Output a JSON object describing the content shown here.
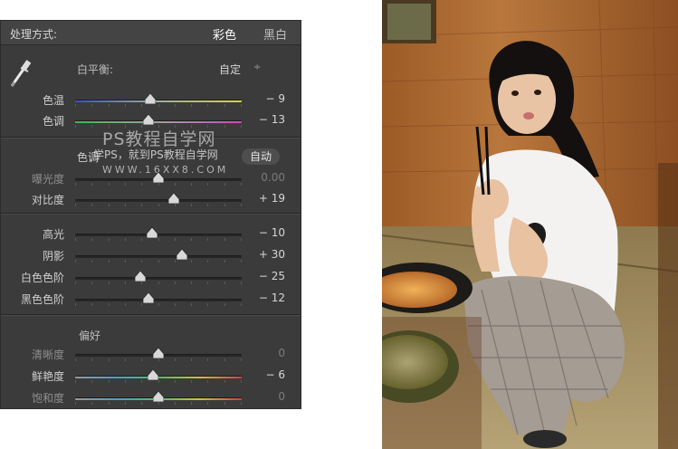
{
  "panel": {
    "header": {
      "title": "处理方式:",
      "option_color": "彩色",
      "option_bw": "黑白"
    },
    "white_balance": {
      "label": "白平衡:",
      "value": "自定",
      "caret": "÷"
    },
    "wb_sliders": [
      {
        "label": "色温",
        "value": "− 9",
        "fraction": 0.45,
        "dim": false
      },
      {
        "label": "色调",
        "value": "− 13",
        "fraction": 0.44,
        "dim": false
      }
    ],
    "tone": {
      "label": "色调",
      "auto": "自动"
    },
    "tone_sliders": [
      {
        "label": "曝光度",
        "value": "0.00",
        "fraction": 0.5,
        "dim": true
      },
      {
        "label": "对比度",
        "value": "+ 19",
        "fraction": 0.59,
        "dim": false
      }
    ],
    "presence_sliders": [
      {
        "label": "高光",
        "value": "− 10",
        "fraction": 0.46,
        "dim": false
      },
      {
        "label": "阴影",
        "value": "+ 30",
        "fraction": 0.64,
        "dim": false
      },
      {
        "label": "白色色阶",
        "value": "− 25",
        "fraction": 0.39,
        "dim": false
      },
      {
        "label": "黑色色阶",
        "value": "− 12",
        "fraction": 0.44,
        "dim": false
      }
    ],
    "preference": {
      "label": "偏好"
    },
    "pref_sliders": [
      {
        "label": "清晰度",
        "value": "0",
        "fraction": 0.5,
        "dim": true
      },
      {
        "label": "鲜艳度",
        "value": "− 6",
        "fraction": 0.47,
        "dim": false
      },
      {
        "label": "饱和度",
        "value": "0",
        "fraction": 0.5,
        "dim": true
      }
    ],
    "watermark": {
      "line1": "PS教程自学网",
      "line2": "学PS，就到PS教程自学网",
      "line3": "WWW.16XX8.COM"
    }
  },
  "photo": {
    "description_icon": "photo-icon",
    "subject": "woman-with-chopsticks-photo"
  }
}
